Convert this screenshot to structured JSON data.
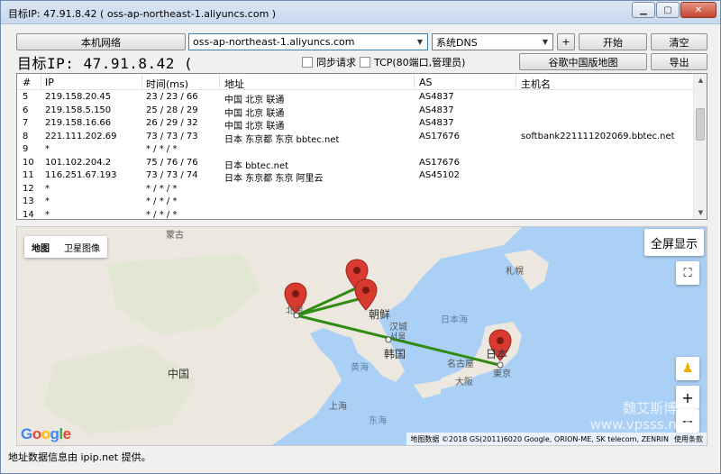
{
  "window": {
    "title": "目标IP: 47.91.8.42 ( oss-ap-northeast-1.aliyuncs.com )"
  },
  "toolbar": {
    "local_network": "本机网络",
    "host_input": "oss-ap-northeast-1.aliyuncs.com",
    "dns_select": "系统DNS",
    "plus": "+",
    "start": "开始",
    "clear": "清空",
    "sync_request": "同步请求",
    "tcp_mode": "TCP(80端口,管理员)",
    "google_china_map": "谷歌中国版地图",
    "export": "导出"
  },
  "target_heading": "目标IP: 47.91.8.42 (",
  "table": {
    "headers": [
      "#",
      "IP",
      "时间(ms)",
      "地址",
      "AS",
      "主机名"
    ],
    "rows": [
      [
        "5",
        "219.158.20.45",
        "23 / 23 / 66",
        "中国 北京 联通",
        "AS4837",
        ""
      ],
      [
        "6",
        "219.158.5.150",
        "25 / 28 / 29",
        "中国 北京 联通",
        "AS4837",
        ""
      ],
      [
        "7",
        "219.158.16.66",
        "26 / 29 / 32",
        "中国 北京 联通",
        "AS4837",
        ""
      ],
      [
        "8",
        "221.111.202.69",
        "73 / 73 / 73",
        "日本 东京都 东京 bbtec.net",
        "AS17676",
        "softbank221111202069.bbtec.net"
      ],
      [
        "9",
        "*",
        "* / * / *",
        "",
        "",
        ""
      ],
      [
        "10",
        "101.102.204.2",
        "75 / 76 / 76",
        "日本 bbtec.net",
        "AS17676",
        ""
      ],
      [
        "11",
        "116.251.67.193",
        "73 / 73 / 74",
        "日本 东京都 东京 阿里云",
        "AS45102",
        ""
      ],
      [
        "12",
        "*",
        "* / * / *",
        "",
        "",
        ""
      ],
      [
        "13",
        "*",
        "* / * / *",
        "",
        "",
        ""
      ],
      [
        "14",
        "*",
        "* / * / *",
        "",
        "",
        ""
      ]
    ]
  },
  "map": {
    "tab_map": "地图",
    "tab_satellite": "卫星图像",
    "fullscreen": "全屏显示",
    "labels": {
      "mongolia": "蒙古",
      "china": "中国",
      "korea_n": "朝鲜",
      "korea_s": "韩国",
      "seoul_a": "汉城",
      "seoul_b": "서울",
      "japan": "日本",
      "japan_sea": "日本海",
      "yellow_sea": "黄海",
      "east_sea": "东海",
      "shanghai": "上海",
      "sapporo": "札幌",
      "nagoya": "名古屋",
      "osaka": "大阪",
      "tokyo": "東京",
      "beijing": "北京"
    },
    "zoom_in": "+",
    "zoom_out": "−",
    "attribution": [
      "地图数据 ©2018 GS(2011)6020 Google, ORION-ME, SK telecom, ZENRIN",
      "使用条款"
    ],
    "google_logo": "Google",
    "watermark_a": "魏艾斯博客",
    "watermark_b": "www.vpsss.net",
    "colors": {
      "route": "#2f8b12",
      "pin": "#d93a2f",
      "water": "#abd0f5",
      "land": "#e9e5dc"
    }
  },
  "status": "地址数据信息由 ipip.net 提供。"
}
